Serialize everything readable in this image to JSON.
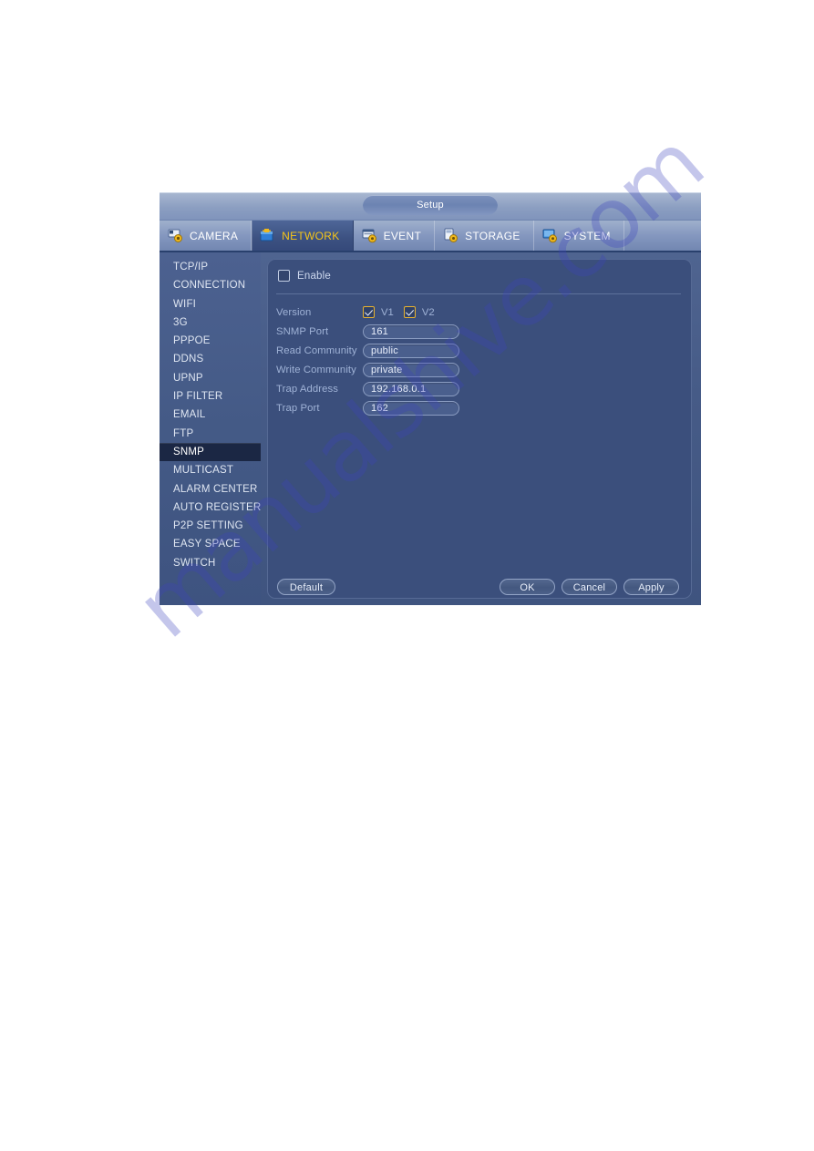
{
  "window": {
    "title": "Setup"
  },
  "tabs": [
    {
      "label": "CAMERA",
      "icon": "camera-gear-icon",
      "active": false
    },
    {
      "label": "NETWORK",
      "icon": "network-gear-icon",
      "active": true
    },
    {
      "label": "EVENT",
      "icon": "event-gear-icon",
      "active": false
    },
    {
      "label": "STORAGE",
      "icon": "storage-gear-icon",
      "active": false
    },
    {
      "label": "SYSTEM",
      "icon": "system-gear-icon",
      "active": false
    }
  ],
  "sidebar": {
    "items": [
      {
        "label": "TCP/IP",
        "selected": false
      },
      {
        "label": "CONNECTION",
        "selected": false
      },
      {
        "label": "WIFI",
        "selected": false
      },
      {
        "label": "3G",
        "selected": false
      },
      {
        "label": "PPPOE",
        "selected": false
      },
      {
        "label": "DDNS",
        "selected": false
      },
      {
        "label": "UPNP",
        "selected": false
      },
      {
        "label": "IP FILTER",
        "selected": false
      },
      {
        "label": "EMAIL",
        "selected": false
      },
      {
        "label": "FTP",
        "selected": false
      },
      {
        "label": "SNMP",
        "selected": true
      },
      {
        "label": "MULTICAST",
        "selected": false
      },
      {
        "label": "ALARM CENTER",
        "selected": false
      },
      {
        "label": "AUTO REGISTER",
        "selected": false
      },
      {
        "label": "P2P SETTING",
        "selected": false
      },
      {
        "label": "EASY SPACE",
        "selected": false
      },
      {
        "label": "SWITCH",
        "selected": false
      }
    ]
  },
  "form": {
    "enable": {
      "label": "Enable",
      "checked": false
    },
    "version": {
      "label": "Version",
      "v1": {
        "label": "V1",
        "checked": true
      },
      "v2": {
        "label": "V2",
        "checked": true
      }
    },
    "snmp_port": {
      "label": "SNMP Port",
      "value": "161"
    },
    "read_community": {
      "label": "Read Community",
      "value": "public"
    },
    "write_community": {
      "label": "Write Community",
      "value": "private"
    },
    "trap_address": {
      "label": "Trap Address",
      "value": "192.168.0.1"
    },
    "trap_port": {
      "label": "Trap Port",
      "value": "162"
    }
  },
  "footer": {
    "default_label": "Default",
    "ok_label": "OK",
    "cancel_label": "Cancel",
    "apply_label": "Apply"
  },
  "watermark": {
    "text": "manualshive.com"
  },
  "colors": {
    "accent_active_tab_text": "#f5c518",
    "dialog_body": "#465b87",
    "content_panel": "#3b4f7c",
    "selected_sidebar": "#1b2744",
    "checkbox_gold": "#e8b22e",
    "label_text": "#9fb2d6"
  }
}
